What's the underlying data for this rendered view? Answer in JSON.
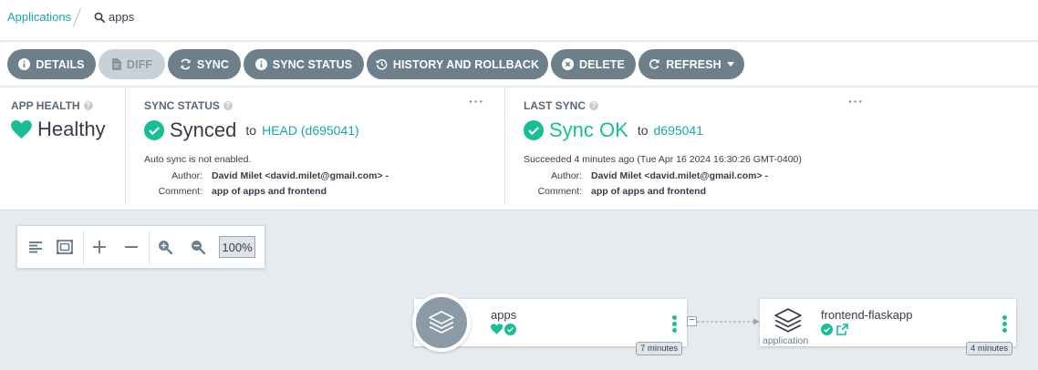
{
  "breadcrumb": {
    "root": "Applications",
    "current": "apps"
  },
  "toolbar": {
    "details": "DETAILS",
    "diff": "DIFF",
    "sync": "SYNC",
    "sync_status": "SYNC STATUS",
    "history": "HISTORY AND ROLLBACK",
    "delete": "DELETE",
    "refresh": "REFRESH"
  },
  "app_health": {
    "title": "APP HEALTH",
    "status": "Healthy"
  },
  "sync_status": {
    "title": "SYNC STATUS",
    "status": "Synced",
    "to": "to",
    "revision": "HEAD (d695041)",
    "auto_sync": "Auto sync is not enabled.",
    "author_label": "Author:",
    "author": "David Milet <david.milet@gmail.com> -",
    "comment_label": "Comment:",
    "comment": "app of apps and frontend"
  },
  "last_sync": {
    "title": "LAST SYNC",
    "status": "Sync OK",
    "to": "to",
    "revision": "d695041",
    "succeeded": "Succeeded 4 minutes ago (Tue Apr 16 2024 16:30:26 GMT-0400)",
    "author_label": "Author:",
    "author": "David Milet <david.milet@gmail.com> -",
    "comment_label": "Comment:",
    "comment": "app of apps and frontend"
  },
  "zoom": {
    "level": "100%"
  },
  "graph": {
    "root_node": {
      "name": "apps",
      "age": "7 minutes"
    },
    "child_node": {
      "name": "frontend-flaskapp",
      "kind": "application",
      "age": "4 minutes"
    },
    "collapse": "−"
  },
  "colors": {
    "accent": "#1aa6a8",
    "healthy": "#18be94",
    "button": "#6d7f8b"
  }
}
